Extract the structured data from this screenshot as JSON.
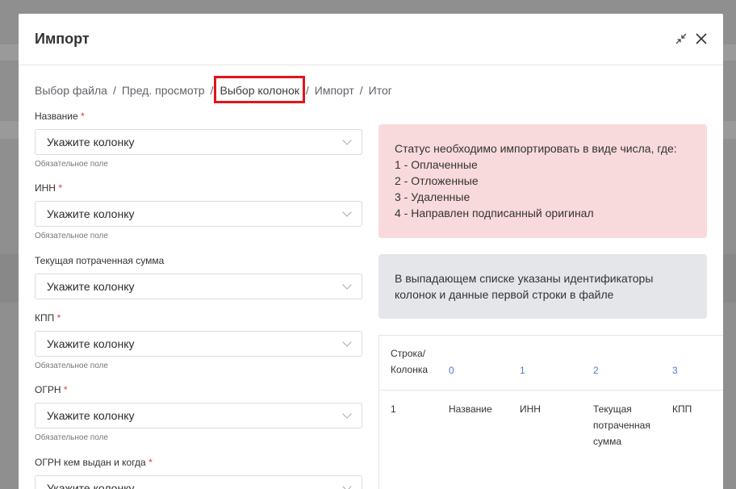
{
  "modal": {
    "title": "Импорт"
  },
  "breadcrumb": [
    {
      "label": "Выбор файла"
    },
    {
      "label": "Пред. просмотр"
    },
    {
      "label": "Выбор колонок"
    },
    {
      "label": "Импорт"
    },
    {
      "label": "Итог"
    }
  ],
  "breadcrumb_separator": "/",
  "fields": [
    {
      "label": "Название",
      "required": "*",
      "value": "Укажите колонку",
      "hint": "Обязательное поле"
    },
    {
      "label": "ИНН",
      "required": "*",
      "value": "Укажите колонку",
      "hint": "Обязательное поле"
    },
    {
      "label": "Текущая потраченная сумма",
      "required": "",
      "value": "Укажите колонку",
      "hint": ""
    },
    {
      "label": "КПП",
      "required": "*",
      "value": "Укажите колонку",
      "hint": "Обязательное поле"
    },
    {
      "label": "ОГРН",
      "required": "*",
      "value": "Укажите колонку",
      "hint": "Обязательное поле"
    },
    {
      "label": "ОГРН кем выдан и когда",
      "required": "*",
      "value": "Укажите колонку",
      "hint": ""
    }
  ],
  "alerts": {
    "status": {
      "line1": "Статус необходимо импортировать в виде числа, где:",
      "line2": "1 - Оплаченные",
      "line3": "2 - Отложенные",
      "line4": "3 - Удаленные",
      "line5": "4 - Направлен подписанный оригинал"
    },
    "info": {
      "line1": "В выпадающем списке указаны идентификаторы",
      "line2": "колонок и данные первой строки в файле"
    }
  },
  "preview_table": {
    "corner_line1": "Строка/",
    "corner_line2": "Колонка",
    "columns": [
      "0",
      "1",
      "2",
      "3"
    ],
    "row": {
      "index": "1",
      "cells": [
        "Название",
        "ИНН",
        "Текущая",
        "потраченная",
        "сумма",
        "КПП"
      ]
    }
  },
  "colors": {
    "required": "#e23b3b",
    "highlight_border": "#e3141b",
    "alert_pink": "#f8dadc",
    "alert_gray": "#e5e6e9",
    "column_link": "#4d7cc7"
  },
  "icons": {
    "collapse": "collapse-arrows-icon",
    "close": "close-icon",
    "dropdown": "chevron-down-icon"
  }
}
